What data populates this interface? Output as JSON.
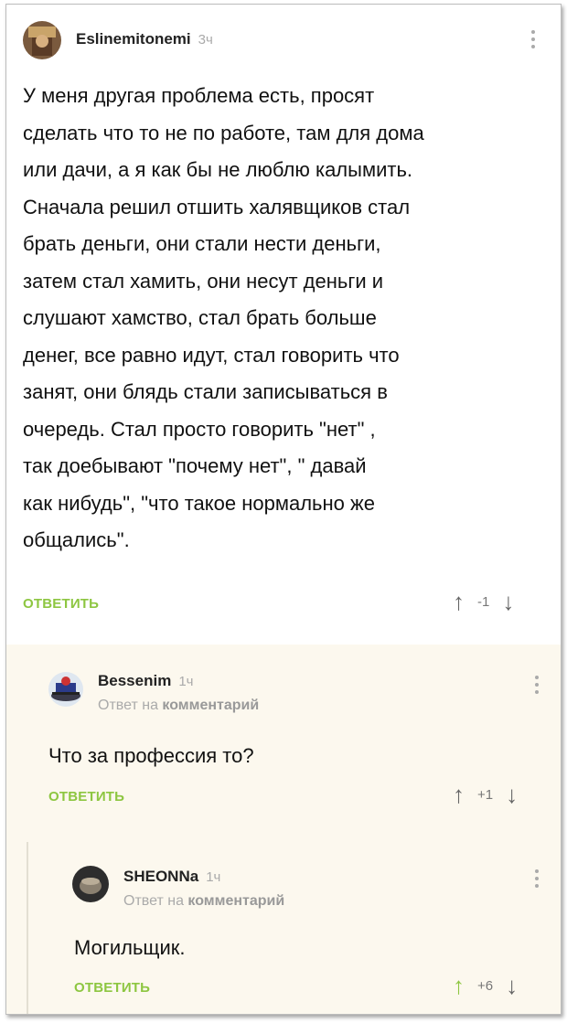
{
  "comments": [
    {
      "author": "Eslinemitonemi",
      "time": "3ч",
      "text_lines": [
        "У меня другая проблема есть, просят",
        "сделать что то не по работе, там для дома",
        "или дачи, а я как бы не люблю калымить.",
        "Сначала решил отшить халявщиков стал",
        "брать деньги, они стали нести деньги,",
        "затем стал хамить, они несут деньги и",
        "слушают хамство, стал брать больше",
        "денег, все равно идут, стал говорить что",
        "занят, они блядь стали записываться в",
        "очередь.  Стал просто говорить \"нет\" ,",
        "так доебывают \"почему нет\", \" давай",
        "как нибудь\", \"что такое нормально же",
        "общались\"."
      ],
      "reply_label": "ОТВЕТИТЬ",
      "rating": "-1",
      "up_icon": "arrow-up-icon",
      "down_icon": "arrow-down-icon"
    },
    {
      "author": "Bessenim",
      "time": "1ч",
      "reply_prefix": "Ответ на",
      "reply_target": "комментарий",
      "text": "Что за профессия то?",
      "reply_label": "ОТВЕТИТЬ",
      "rating": "+1"
    },
    {
      "author": "SHEONNa",
      "time": "1ч",
      "reply_prefix": "Ответ на",
      "reply_target": "комментарий",
      "text": "Могильщик.",
      "reply_label": "ОТВЕТИТЬ",
      "rating": "+6"
    }
  ],
  "colors": {
    "accent": "#8dc641",
    "reply_bg": "#fcf8ee",
    "muted": "#aaaaaa"
  }
}
